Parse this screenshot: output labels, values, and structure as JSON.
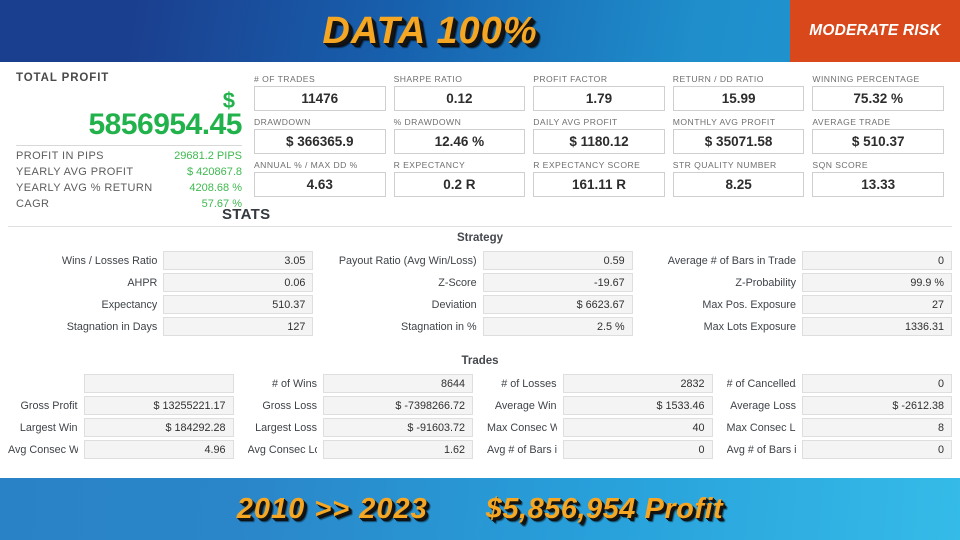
{
  "header": {
    "title": "DATA 100%",
    "risk_label": "MODERATE RISK",
    "risk_color": "#d8481b",
    "accent_color": "#f5a623"
  },
  "total_profit": {
    "heading": "TOTAL PROFIT",
    "currency_symbol": "$",
    "amount": "5856954.45",
    "amount_color": "#22b24c",
    "rows": [
      {
        "label": "PROFIT IN PIPS",
        "value": "29681.2 PIPS"
      },
      {
        "label": "YEARLY AVG PROFIT",
        "value": "$ 420867.8"
      },
      {
        "label": "YEARLY AVG % RETURN",
        "value": "4208.68 %"
      },
      {
        "label": "CAGR",
        "value": "57.67 %"
      }
    ]
  },
  "metrics": [
    {
      "label": "# OF TRADES",
      "value": "11476"
    },
    {
      "label": "SHARPE RATIO",
      "value": "0.12"
    },
    {
      "label": "PROFIT FACTOR",
      "value": "1.79"
    },
    {
      "label": "RETURN / DD RATIO",
      "value": "15.99"
    },
    {
      "label": "WINNING PERCENTAGE",
      "value": "75.32 %"
    },
    {
      "label": "DRAWDOWN",
      "value": "$ 366365.9"
    },
    {
      "label": "% DRAWDOWN",
      "value": "12.46 %"
    },
    {
      "label": "DAILY AVG PROFIT",
      "value": "$ 1180.12"
    },
    {
      "label": "MONTHLY AVG PROFIT",
      "value": "$ 35071.58"
    },
    {
      "label": "AVERAGE TRADE",
      "value": "$ 510.37"
    },
    {
      "label": "ANNUAL % / MAX DD %",
      "value": "4.63"
    },
    {
      "label": "R EXPECTANCY",
      "value": "0.2 R"
    },
    {
      "label": "R EXPECTANCY SCORE",
      "value": "161.11 R"
    },
    {
      "label": "STR QUALITY NUMBER",
      "value": "8.25"
    },
    {
      "label": "SQN SCORE",
      "value": "13.33"
    }
  ],
  "stats": {
    "heading": "STATS",
    "strategy": {
      "title": "Strategy",
      "rows": [
        [
          {
            "label": "Wins / Losses Ratio",
            "value": "3.05"
          },
          {
            "label": "Payout Ratio (Avg Win/Loss)",
            "value": "0.59"
          },
          {
            "label": "Average # of Bars in Trade",
            "value": "0"
          }
        ],
        [
          {
            "label": "AHPR",
            "value": "0.06"
          },
          {
            "label": "Z-Score",
            "value": "-19.67"
          },
          {
            "label": "Z-Probability",
            "value": "99.9 %"
          }
        ],
        [
          {
            "label": "Expectancy",
            "value": "510.37"
          },
          {
            "label": "Deviation",
            "value": "$ 6623.67"
          },
          {
            "label": "Max Pos. Exposure",
            "value": "27"
          }
        ],
        [
          {
            "label": "Stagnation in Days",
            "value": "127"
          },
          {
            "label": "Stagnation in %",
            "value": "2.5 %"
          },
          {
            "label": "Max Lots Exposure",
            "value": "1336.31"
          }
        ]
      ]
    },
    "trades": {
      "title": "Trades",
      "rows": [
        [
          {
            "label": "",
            "value": ""
          },
          {
            "label": "# of Wins",
            "value": "8644"
          },
          {
            "label": "# of Losses",
            "value": "2832"
          },
          {
            "label": "# of Cancelled/Expired",
            "value": "0"
          }
        ],
        [
          {
            "label": "Gross Profit",
            "value": "$ 13255221.17"
          },
          {
            "label": "Gross Loss",
            "value": "$ -7398266.72"
          },
          {
            "label": "Average Win",
            "value": "$ 1533.46"
          },
          {
            "label": "Average Loss",
            "value": "$ -2612.38"
          }
        ],
        [
          {
            "label": "Largest Win",
            "value": "$ 184292.28"
          },
          {
            "label": "Largest Loss",
            "value": "$ -91603.72"
          },
          {
            "label": "Max Consec Wins",
            "value": "40"
          },
          {
            "label": "Max Consec Losses",
            "value": "8"
          }
        ],
        [
          {
            "label": "Avg Consec Wins",
            "value": "4.96"
          },
          {
            "label": "Avg Consec Loss",
            "value": "1.62"
          },
          {
            "label": "Avg # of Bars in Wins",
            "value": "0"
          },
          {
            "label": "Avg # of Bars in Losses",
            "value": "0"
          }
        ]
      ]
    }
  },
  "footer": {
    "years": "2010 >> 2023",
    "profit": "$5,856,954 Profit"
  }
}
